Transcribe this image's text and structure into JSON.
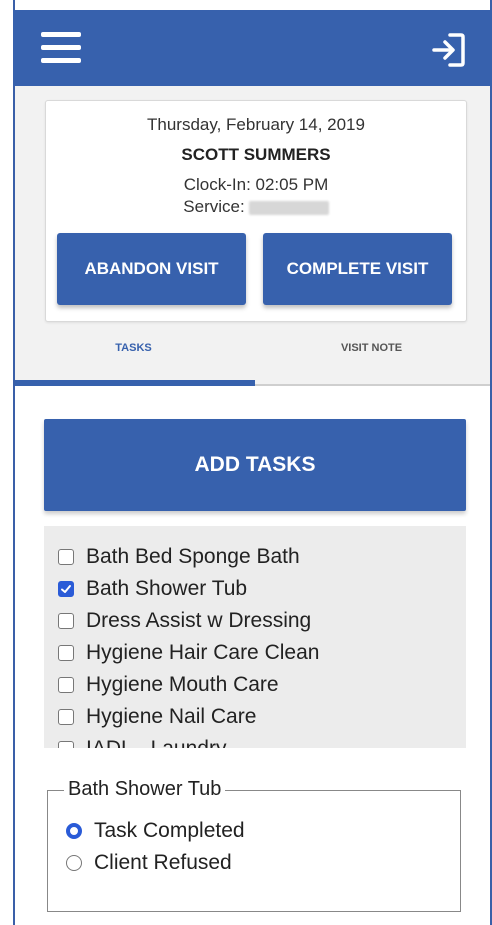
{
  "visit": {
    "date": "Thursday, February 14, 2019",
    "client_name": "SCOTT SUMMERS",
    "clock_in": "Clock-In: 02:05 PM",
    "service_label": "Service:"
  },
  "buttons": {
    "abandon": "ABANDON VISIT",
    "complete": "COMPLETE VISIT",
    "add_tasks": "ADD TASKS"
  },
  "tabs": [
    {
      "label": "TASKS",
      "active": true
    },
    {
      "label": "VISIT NOTE",
      "active": false
    }
  ],
  "tasks": [
    {
      "label": "Bath Bed Sponge Bath",
      "checked": false
    },
    {
      "label": "Bath Shower Tub",
      "checked": true
    },
    {
      "label": "Dress Assist w Dressing",
      "checked": false
    },
    {
      "label": "Hygiene Hair Care Clean",
      "checked": false
    },
    {
      "label": "Hygiene Mouth Care",
      "checked": false
    },
    {
      "label": "Hygiene Nail Care",
      "checked": false
    },
    {
      "label": "IADL - Laundry",
      "checked": false
    }
  ],
  "task_status": {
    "title": "Bath Shower Tub",
    "options": [
      {
        "label": "Task Completed",
        "selected": true
      },
      {
        "label": "Client Refused",
        "selected": false
      }
    ]
  },
  "colors": {
    "primary": "#3761ad",
    "checkbox": "#2a5bd7"
  },
  "icons": {
    "menu": "hamburger-menu-icon",
    "logout": "logout-icon"
  }
}
